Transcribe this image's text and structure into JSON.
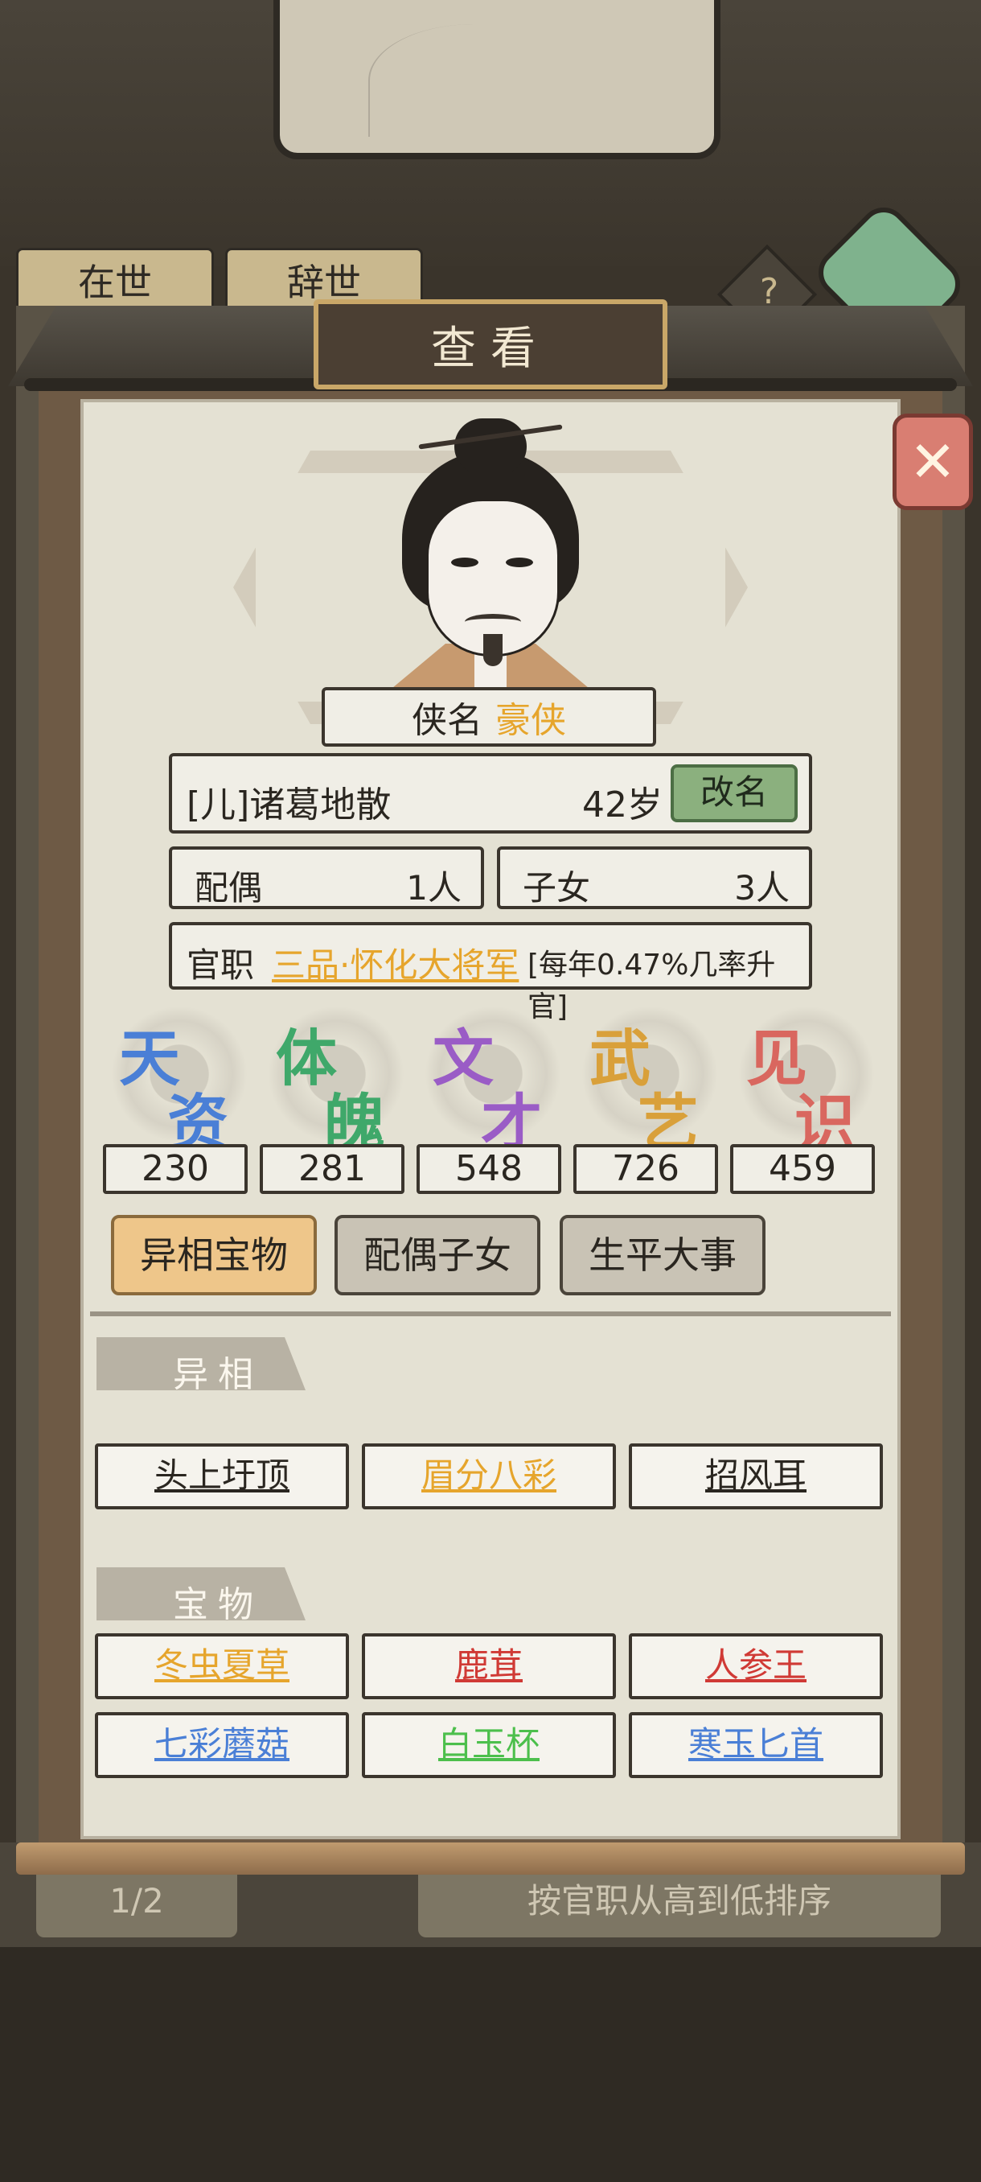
{
  "background": {
    "tabs": [
      "在世",
      "辞世"
    ],
    "pager": "1/2",
    "sort_label": "按官职从高到低排序",
    "help": "?"
  },
  "dialog": {
    "title": "查看",
    "close_icon": "close-x-icon"
  },
  "profile": {
    "title_label": "侠名",
    "title_value": "豪侠",
    "name": "[儿]诸葛地散",
    "age": "42岁",
    "rename_label": "改名",
    "spouse_label": "配偶",
    "spouse_value": "1人",
    "children_label": "子女",
    "children_value": "3人",
    "office_label": "官职",
    "office_rank": "三品·怀化大将军",
    "office_rate": "[每年0.47%几率升官]"
  },
  "stats": [
    {
      "line1": "天",
      "line2": "资",
      "value": "230",
      "color": "#4a7fd6"
    },
    {
      "line1": "体",
      "line2": "魄",
      "value": "281",
      "color": "#3fa86a"
    },
    {
      "line1": "文",
      "line2": "才",
      "value": "548",
      "color": "#9a5cc6"
    },
    {
      "line1": "武",
      "line2": "艺",
      "value": "726",
      "color": "#d9a03a"
    },
    {
      "line1": "见",
      "line2": "识",
      "value": "459",
      "color": "#d9675f"
    }
  ],
  "tabs": [
    {
      "label": "异相宝物",
      "active": true
    },
    {
      "label": "配偶子女",
      "active": false
    },
    {
      "label": "生平大事",
      "active": false
    }
  ],
  "traits_label": "异相",
  "traits": [
    {
      "label": "头上圩顶",
      "color": "#2a2620"
    },
    {
      "label": "眉分八彩",
      "color": "#e6a52c"
    },
    {
      "label": "招风耳",
      "color": "#2a2620"
    }
  ],
  "treasures_label": "宝物",
  "treasures": [
    {
      "label": "冬虫夏草",
      "color": "#e6a52c"
    },
    {
      "label": "鹿茸",
      "color": "#d03a35"
    },
    {
      "label": "人参王",
      "color": "#d03a35"
    },
    {
      "label": "七彩蘑菇",
      "color": "#4a7fd6"
    },
    {
      "label": "白玉杯",
      "color": "#4cbf4c"
    },
    {
      "label": "寒玉匕首",
      "color": "#4a7fd6"
    }
  ]
}
